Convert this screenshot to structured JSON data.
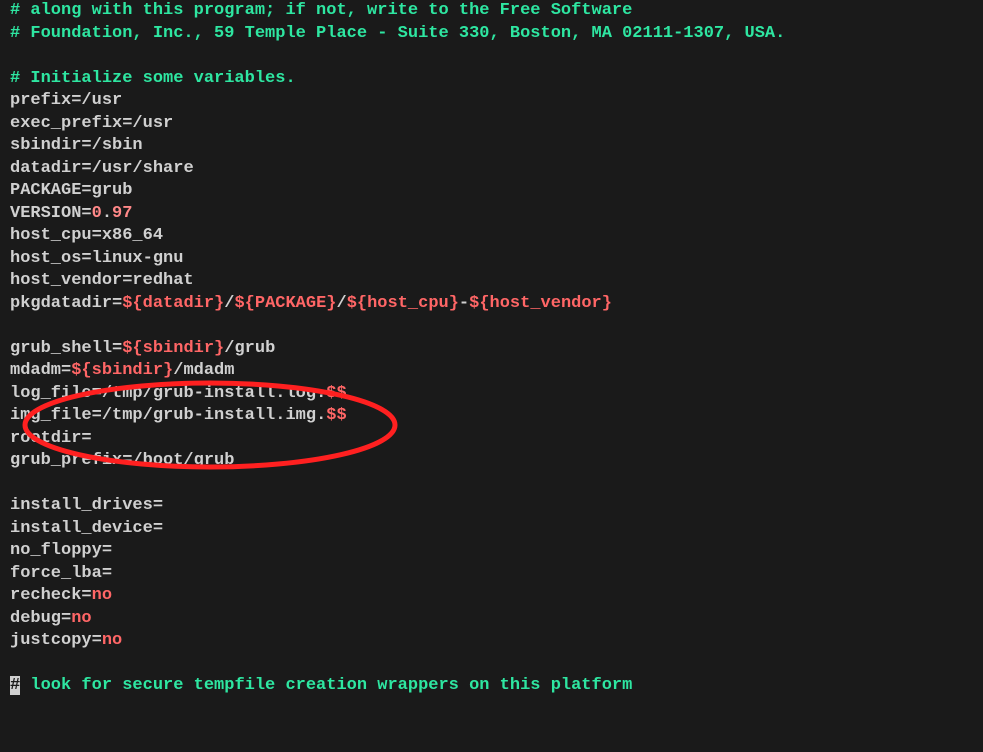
{
  "comments": {
    "c1": "# along with this program; if not, write to the Free Software",
    "c2": "# Foundation, Inc., 59 Temple Place - Suite 330, Boston, MA 02111-1307, USA.",
    "c3": "# Initialize some variables.",
    "c4_rest": " look for secure tempfile creation wrappers on this platform",
    "hash": "#"
  },
  "vars": {
    "prefix": {
      "name": "prefix",
      "eq": "=",
      "val": "/usr"
    },
    "exec_prefix": {
      "name": "exec_prefix",
      "eq": "=",
      "val": "/usr"
    },
    "sbindir": {
      "name": "sbindir",
      "eq": "=",
      "val": "/sbin"
    },
    "datadir": {
      "name": "datadir",
      "eq": "=",
      "val": "/usr/share"
    },
    "package": {
      "name": "PACKAGE",
      "eq": "=",
      "val": "grub"
    },
    "version": {
      "name": "VERSION",
      "eq": "=",
      "val_pre": "",
      "num1": "0",
      "dot": ".",
      "num2": "97"
    },
    "host_cpu": {
      "name": "host_cpu",
      "eq": "=",
      "val": "x86_64"
    },
    "host_os": {
      "name": "host_os",
      "eq": "=",
      "val": "linux-gnu"
    },
    "host_vendor": {
      "name": "host_vendor",
      "eq": "=",
      "val": "redhat"
    },
    "pkgdatadir": {
      "name": "pkgdatadir",
      "eq": "=",
      "s1": "${datadir}",
      "t1": "/",
      "s2": "${PACKAGE}",
      "t2": "/",
      "s3": "${host_cpu}",
      "t3": "-",
      "s4": "${host_vendor}"
    },
    "grub_shell": {
      "name": "grub_shell",
      "eq": "=",
      "s1": "${sbindir}",
      "t1": "/grub"
    },
    "mdadm": {
      "name": "mdadm",
      "eq": "=",
      "s1": "${sbindir}",
      "t1": "/mdadm"
    },
    "log_file": {
      "name": "log_file",
      "eq": "=",
      "t1": "/tmp/grub-install.log.",
      "s1": "$$"
    },
    "img_file": {
      "name": "img_file",
      "eq": "=",
      "t1": "/tmp/grub-install.img.",
      "s1": "$$"
    },
    "rootdir": {
      "name": "rootdir",
      "eq": "="
    },
    "grub_prefix": {
      "name": "grub_prefix",
      "eq": "=",
      "val": "/boot/grub"
    },
    "install_drives": {
      "name": "install_drives",
      "eq": "="
    },
    "install_device": {
      "name": "install_device",
      "eq": "="
    },
    "no_floppy": {
      "name": "no_floppy",
      "eq": "="
    },
    "force_lba": {
      "name": "force_lba",
      "eq": "="
    },
    "recheck": {
      "name": "recheck",
      "eq": "=",
      "val": "no"
    },
    "debug": {
      "name": "debug",
      "eq": "=",
      "val": "no"
    },
    "justcopy": {
      "name": "justcopy",
      "eq": "=",
      "val": "no"
    }
  },
  "annotation": {
    "circle_color": "#ff2020"
  }
}
